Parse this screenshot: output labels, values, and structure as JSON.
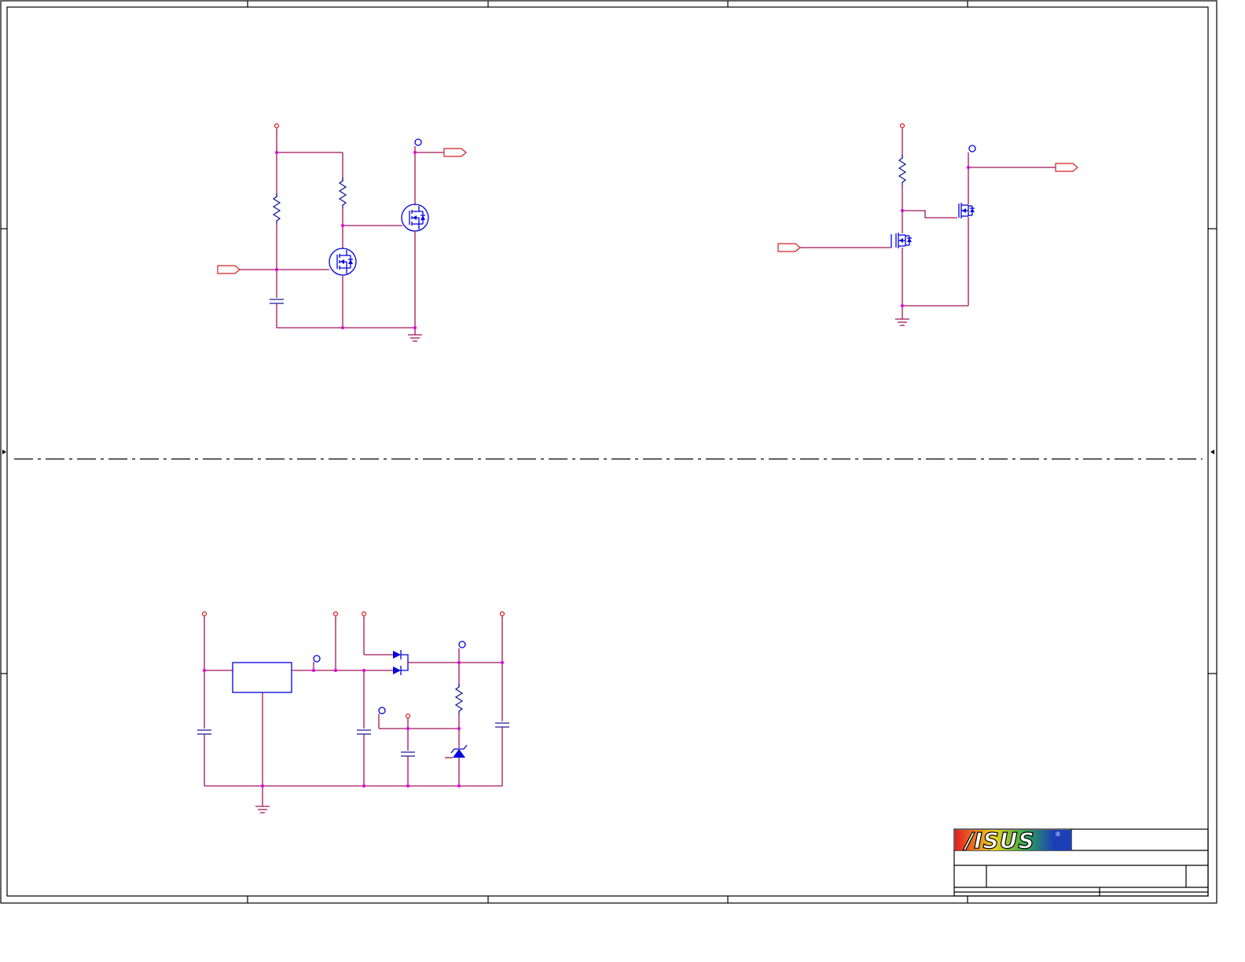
{
  "sheet": {
    "title_block": {
      "logo_text": "/ISUS",
      "logo_registered": "®",
      "logo_colors": [
        "#e31b23",
        "#f2d21b",
        "#2fa84f",
        "#1c3fb8"
      ]
    }
  },
  "colors": {
    "wire": "#a0155a",
    "component": "#1a1a99",
    "device": "#0000e0",
    "port": "#d42020",
    "junction": "#e000e0"
  },
  "icons": [
    "mosfet-icon",
    "resistor-icon",
    "capacitor-icon",
    "ground-icon",
    "diode-icon",
    "zener-icon",
    "port-arrow-icon",
    "power-pin-icon"
  ]
}
